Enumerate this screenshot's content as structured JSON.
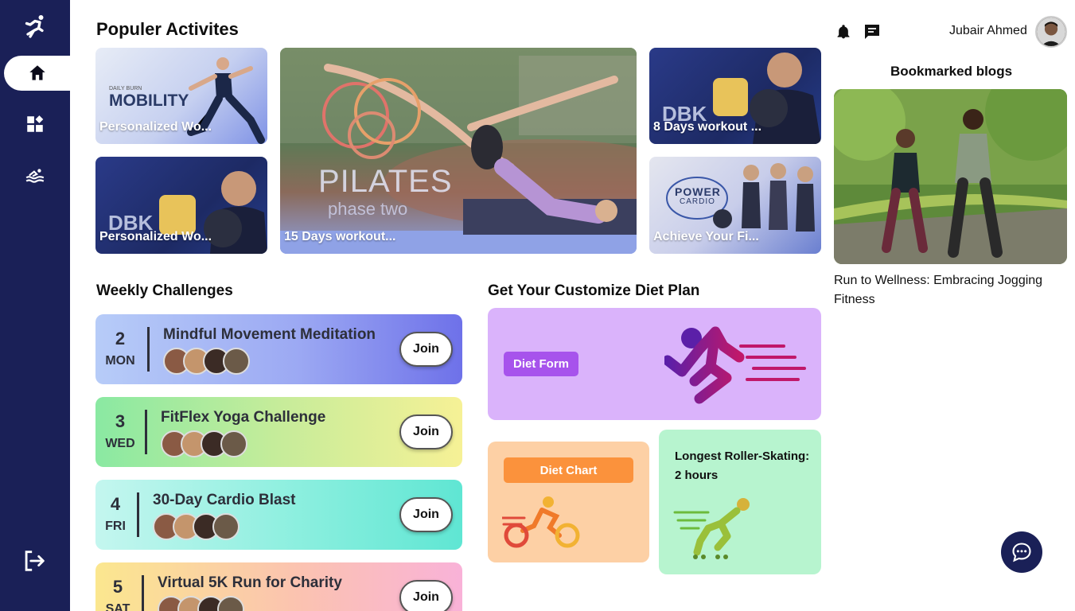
{
  "sidebar": {
    "items": [
      {
        "name": "home",
        "icon": "home-icon",
        "active": true
      },
      {
        "name": "dashboard",
        "icon": "widgets-icon",
        "active": false
      },
      {
        "name": "swimming",
        "icon": "swim-icon",
        "active": false
      }
    ],
    "bg": "#1a2057"
  },
  "popular": {
    "title": "Populer Activites",
    "cards": [
      {
        "label": "Personalized Wo...",
        "art_text": "MOBILITY",
        "small_text": "DAILY BURN"
      },
      {
        "label": "Personalized Wo...",
        "art_text": "DBK"
      },
      {
        "label": "15 Days workout...",
        "art_text": "PILATES",
        "art_sub": "phase two"
      },
      {
        "label": "8 Days workout ...",
        "art_text": "DBK"
      },
      {
        "label": "Achieve Your Fi...",
        "art_text": "POWER",
        "art_sub": "CARDIO"
      }
    ]
  },
  "challenges": {
    "title": "Weekly Challenges",
    "join_label": "Join",
    "items": [
      {
        "num": "2",
        "day": "MON",
        "title": "Mindful Movement Meditation"
      },
      {
        "num": "3",
        "day": "WED",
        "title": "FitFlex Yoga Challenge"
      },
      {
        "num": "4",
        "day": "FRI",
        "title": "30-Day Cardio Blast"
      },
      {
        "num": "5",
        "day": "SAT",
        "title": "Virtual 5K Run for Charity"
      }
    ]
  },
  "diet": {
    "title": "Get Your Customize Diet Plan",
    "form_label": "Diet Form",
    "chart_label": "Diet Chart",
    "roller_text": "Longest Roller-Skating: 2 hours"
  },
  "header": {
    "user_name": "Jubair Ahmed"
  },
  "blogs": {
    "title": "Bookmarked blogs",
    "items": [
      {
        "title": "Run to Wellness: Embracing Jogging Fitness"
      }
    ]
  }
}
